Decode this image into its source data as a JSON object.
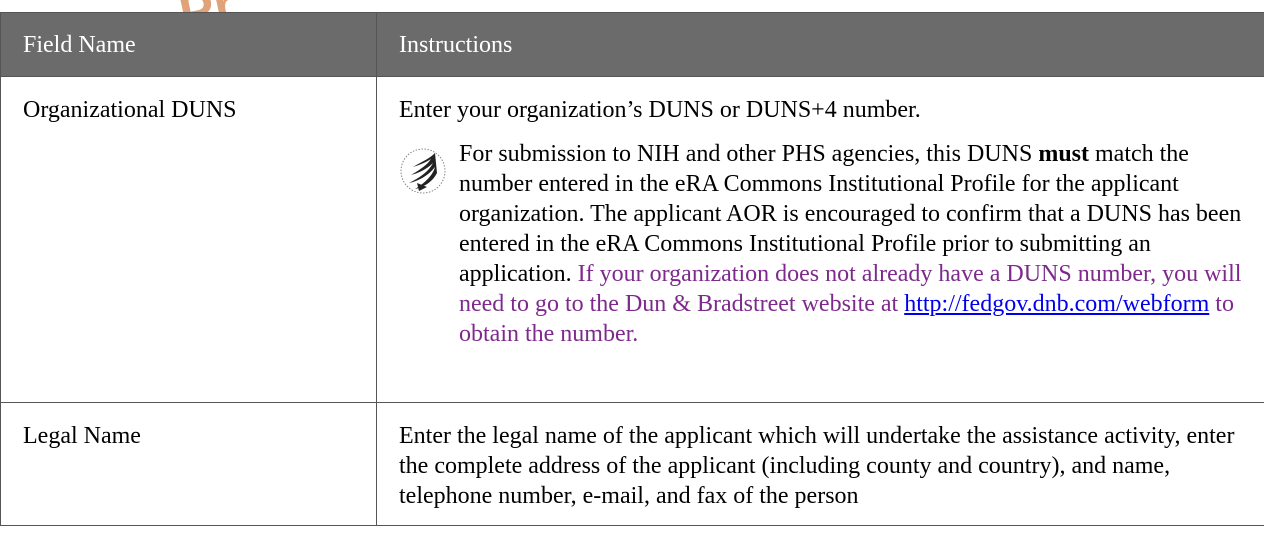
{
  "watermark_text": "Pr",
  "table": {
    "headers": {
      "field_name": "Field Name",
      "instructions": "Instructions"
    },
    "rows": [
      {
        "field": "Organizational DUNS",
        "instruction": "Enter your organization’s DUNS or DUNS+4 number.",
        "note": {
          "icon": "hhs-eagle-seal-icon",
          "text_1": "For submission to NIH and other PHS agencies, this DUNS ",
          "bold": "must",
          "text_2": " match the number entered in the eRA Commons Institutional Profile for the applicant organization. The applicant AOR is encouraged to confirm that a DUNS has been entered in the eRA Commons Institutional Profile prior to submitting an application. ",
          "purple_text": "If your organization does not already have a DUNS number, you will need to go to the Dun & Bradstreet website at ",
          "link_text": "http://fedgov.dnb.com/webform",
          "purple_text_end": " to obtain the number.",
          "purple_color": "#7d2a8c"
        }
      },
      {
        "field": "Legal Name",
        "instruction": "Enter the legal name of the applicant which will undertake the assistance activity, enter the complete address of the applicant (including county and country), and name, telephone number, e-mail, and fax of the person"
      }
    ]
  },
  "colors": {
    "header_bg": "#6b6b6b",
    "header_text": "#ffffff",
    "border": "#555555",
    "link": "#0000ee"
  }
}
